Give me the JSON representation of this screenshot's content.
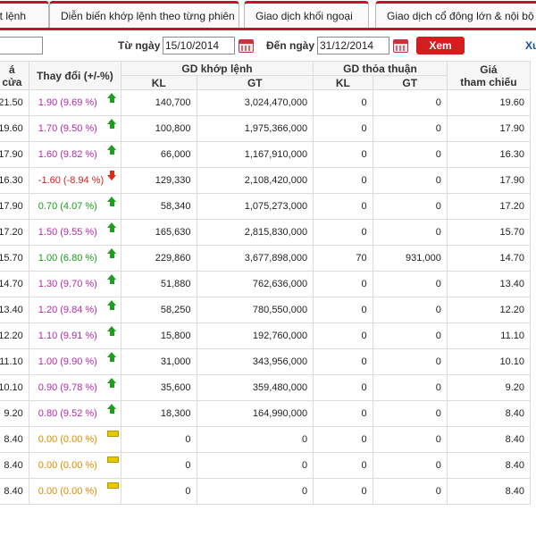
{
  "tabs": [
    {
      "label": "ất lệnh"
    },
    {
      "label": "Diễn biến khớp lệnh theo từng phiên"
    },
    {
      "label": "Giao dịch khối ngoại"
    },
    {
      "label": "Giao dịch cổ đông lớn & nội bộ"
    }
  ],
  "filter": {
    "code_value": "",
    "from_label": "Từ ngày",
    "from_date": "15/10/2014",
    "to_label": "Đến ngày",
    "to_date": "31/12/2014",
    "view_button": "Xem",
    "export_link": "Xu"
  },
  "table": {
    "headers": {
      "close_line1": "á",
      "close_line2": "cửa",
      "change": "Thay đổi (+/-%)",
      "matched_group": "GD khớp lệnh",
      "matched_kl": "KL",
      "matched_gt": "GT",
      "negotiated_group": "GD thỏa thuận",
      "negotiated_kl": "KL",
      "negotiated_gt": "GT",
      "ref_line1": "Giá",
      "ref_line2": "tham chiếu"
    },
    "rows": [
      {
        "close": "21.50",
        "change": "1.90 (9.69 %)",
        "trend": "ceil",
        "kl": "140,700",
        "gt": "3,024,470,000",
        "tt_kl": "0",
        "tt_gt": "0",
        "ref": "19.60"
      },
      {
        "close": "19.60",
        "change": "1.70 (9.50 %)",
        "trend": "ceil",
        "kl": "100,800",
        "gt": "1,975,366,000",
        "tt_kl": "0",
        "tt_gt": "0",
        "ref": "17.90"
      },
      {
        "close": "17.90",
        "change": "1.60 (9.82 %)",
        "trend": "ceil",
        "kl": "66,000",
        "gt": "1,167,910,000",
        "tt_kl": "0",
        "tt_gt": "0",
        "ref": "16.30"
      },
      {
        "close": "16.30",
        "change": "-1.60 (-8.94 %)",
        "trend": "down",
        "kl": "129,330",
        "gt": "2,108,420,000",
        "tt_kl": "0",
        "tt_gt": "0",
        "ref": "17.90"
      },
      {
        "close": "17.90",
        "change": "0.70 (4.07 %)",
        "trend": "up",
        "kl": "58,340",
        "gt": "1,075,273,000",
        "tt_kl": "0",
        "tt_gt": "0",
        "ref": "17.20"
      },
      {
        "close": "17.20",
        "change": "1.50 (9.55 %)",
        "trend": "ceil",
        "kl": "165,630",
        "gt": "2,815,830,000",
        "tt_kl": "0",
        "tt_gt": "0",
        "ref": "15.70"
      },
      {
        "close": "15.70",
        "change": "1.00 (6.80 %)",
        "trend": "up",
        "kl": "229,860",
        "gt": "3,677,898,000",
        "tt_kl": "70",
        "tt_gt": "931,000",
        "ref": "14.70"
      },
      {
        "close": "14.70",
        "change": "1.30 (9.70 %)",
        "trend": "ceil",
        "kl": "51,880",
        "gt": "762,636,000",
        "tt_kl": "0",
        "tt_gt": "0",
        "ref": "13.40"
      },
      {
        "close": "13.40",
        "change": "1.20 (9.84 %)",
        "trend": "ceil",
        "kl": "58,250",
        "gt": "780,550,000",
        "tt_kl": "0",
        "tt_gt": "0",
        "ref": "12.20"
      },
      {
        "close": "12.20",
        "change": "1.10 (9.91 %)",
        "trend": "ceil",
        "kl": "15,800",
        "gt": "192,760,000",
        "tt_kl": "0",
        "tt_gt": "0",
        "ref": "11.10"
      },
      {
        "close": "11.10",
        "change": "1.00 (9.90 %)",
        "trend": "ceil",
        "kl": "31,000",
        "gt": "343,956,000",
        "tt_kl": "0",
        "tt_gt": "0",
        "ref": "10.10"
      },
      {
        "close": "10.10",
        "change": "0.90 (9.78 %)",
        "trend": "ceil",
        "kl": "35,600",
        "gt": "359,480,000",
        "tt_kl": "0",
        "tt_gt": "0",
        "ref": "9.20"
      },
      {
        "close": "9.20",
        "change": "0.80 (9.52 %)",
        "trend": "ceil",
        "kl": "18,300",
        "gt": "164,990,000",
        "tt_kl": "0",
        "tt_gt": "0",
        "ref": "8.40"
      },
      {
        "close": "8.40",
        "change": "0.00 (0.00 %)",
        "trend": "flat",
        "kl": "0",
        "gt": "0",
        "tt_kl": "0",
        "tt_gt": "0",
        "ref": "8.40"
      },
      {
        "close": "8.40",
        "change": "0.00 (0.00 %)",
        "trend": "flat",
        "kl": "0",
        "gt": "0",
        "tt_kl": "0",
        "tt_gt": "0",
        "ref": "8.40"
      },
      {
        "close": "8.40",
        "change": "0.00 (0.00 %)",
        "trend": "flat",
        "kl": "0",
        "gt": "0",
        "tt_kl": "0",
        "tt_gt": "0",
        "ref": "8.40"
      }
    ]
  },
  "colors": {
    "accent": "#c8102e",
    "button": "#d41d1d",
    "ceiling": "#b52aa8",
    "increase": "#1c9a1c",
    "decrease": "#d42020",
    "unchanged": "#e08a00"
  },
  "icons": {
    "calendar": "calendar-icon",
    "up": "arrow-up-icon",
    "down": "arrow-down-icon",
    "flat": "unchanged-icon"
  }
}
